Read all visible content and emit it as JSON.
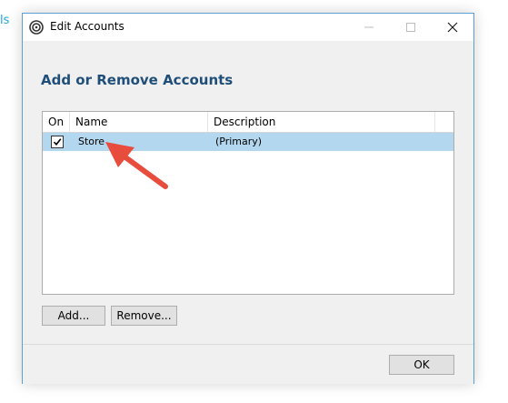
{
  "background": {
    "fragment": "ls"
  },
  "window": {
    "title": "Edit Accounts",
    "icons": {
      "app": "app-logo-icon",
      "minimize": "minimize-icon",
      "maximize": "maximize-icon",
      "close": "close-icon"
    }
  },
  "dialog": {
    "heading": "Add or Remove Accounts",
    "columns": {
      "on": "On",
      "name": "Name",
      "description": "Description"
    },
    "rows": [
      {
        "checked": true,
        "name": "Store",
        "description": "(Primary)"
      }
    ],
    "buttons": {
      "add": "Add...",
      "remove": "Remove...",
      "ok": "OK"
    }
  },
  "colors": {
    "heading": "#1f4e79",
    "row_selected": "#b3d7ee",
    "annotation_arrow": "#e84c3d",
    "window_border": "#5f9fcf"
  }
}
